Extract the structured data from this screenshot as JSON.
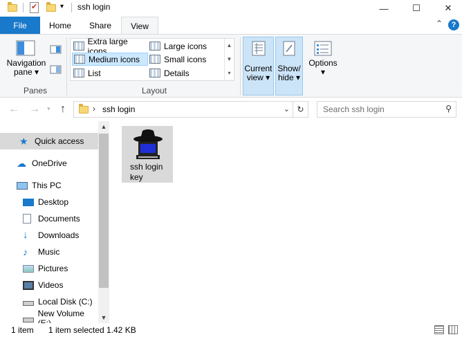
{
  "window": {
    "title": "ssh login",
    "minimize": "—",
    "maximize": "☐",
    "close": "✕"
  },
  "ribbon": {
    "tabs": [
      "File",
      "Home",
      "Share",
      "View"
    ],
    "active_tab": "View",
    "panes_group": {
      "label": "Panes",
      "navigation_pane": [
        "Navigation",
        "pane ▾"
      ]
    },
    "layout_group": {
      "label": "Layout",
      "items": [
        "Extra large icons",
        "Large icons",
        "Medium icons",
        "Small icons",
        "List",
        "Details"
      ],
      "selected": "Medium icons"
    },
    "current_view": [
      "Current",
      "view ▾"
    ],
    "show_hide": [
      "Show/",
      "hide ▾"
    ],
    "options": [
      "Options",
      "▾"
    ],
    "accent": "#1979ca"
  },
  "address": {
    "path": "ssh login",
    "search_placeholder": "Search ssh login"
  },
  "nav": {
    "items": [
      {
        "label": "Quick access",
        "icon": "star-icon"
      },
      {
        "label": "OneDrive",
        "icon": "cloud-icon"
      },
      {
        "label": "This PC",
        "icon": "computer-icon"
      },
      {
        "label": "Desktop",
        "icon": "desktop-icon"
      },
      {
        "label": "Documents",
        "icon": "documents-icon"
      },
      {
        "label": "Downloads",
        "icon": "download-icon"
      },
      {
        "label": "Music",
        "icon": "music-icon"
      },
      {
        "label": "Pictures",
        "icon": "pictures-icon"
      },
      {
        "label": "Videos",
        "icon": "videos-icon"
      },
      {
        "label": "Local Disk (C:)",
        "icon": "drive-icon"
      },
      {
        "label": "New Volume (E:)",
        "icon": "drive-icon"
      }
    ],
    "selected": "Quick access"
  },
  "content": {
    "files": [
      {
        "name": "ssh login key",
        "lines": [
          "ssh login",
          "key"
        ],
        "icon": "ssh-terminal-icon"
      }
    ]
  },
  "status": {
    "count": "1 item",
    "selection": "1 item selected",
    "size": "1.42 KB"
  }
}
